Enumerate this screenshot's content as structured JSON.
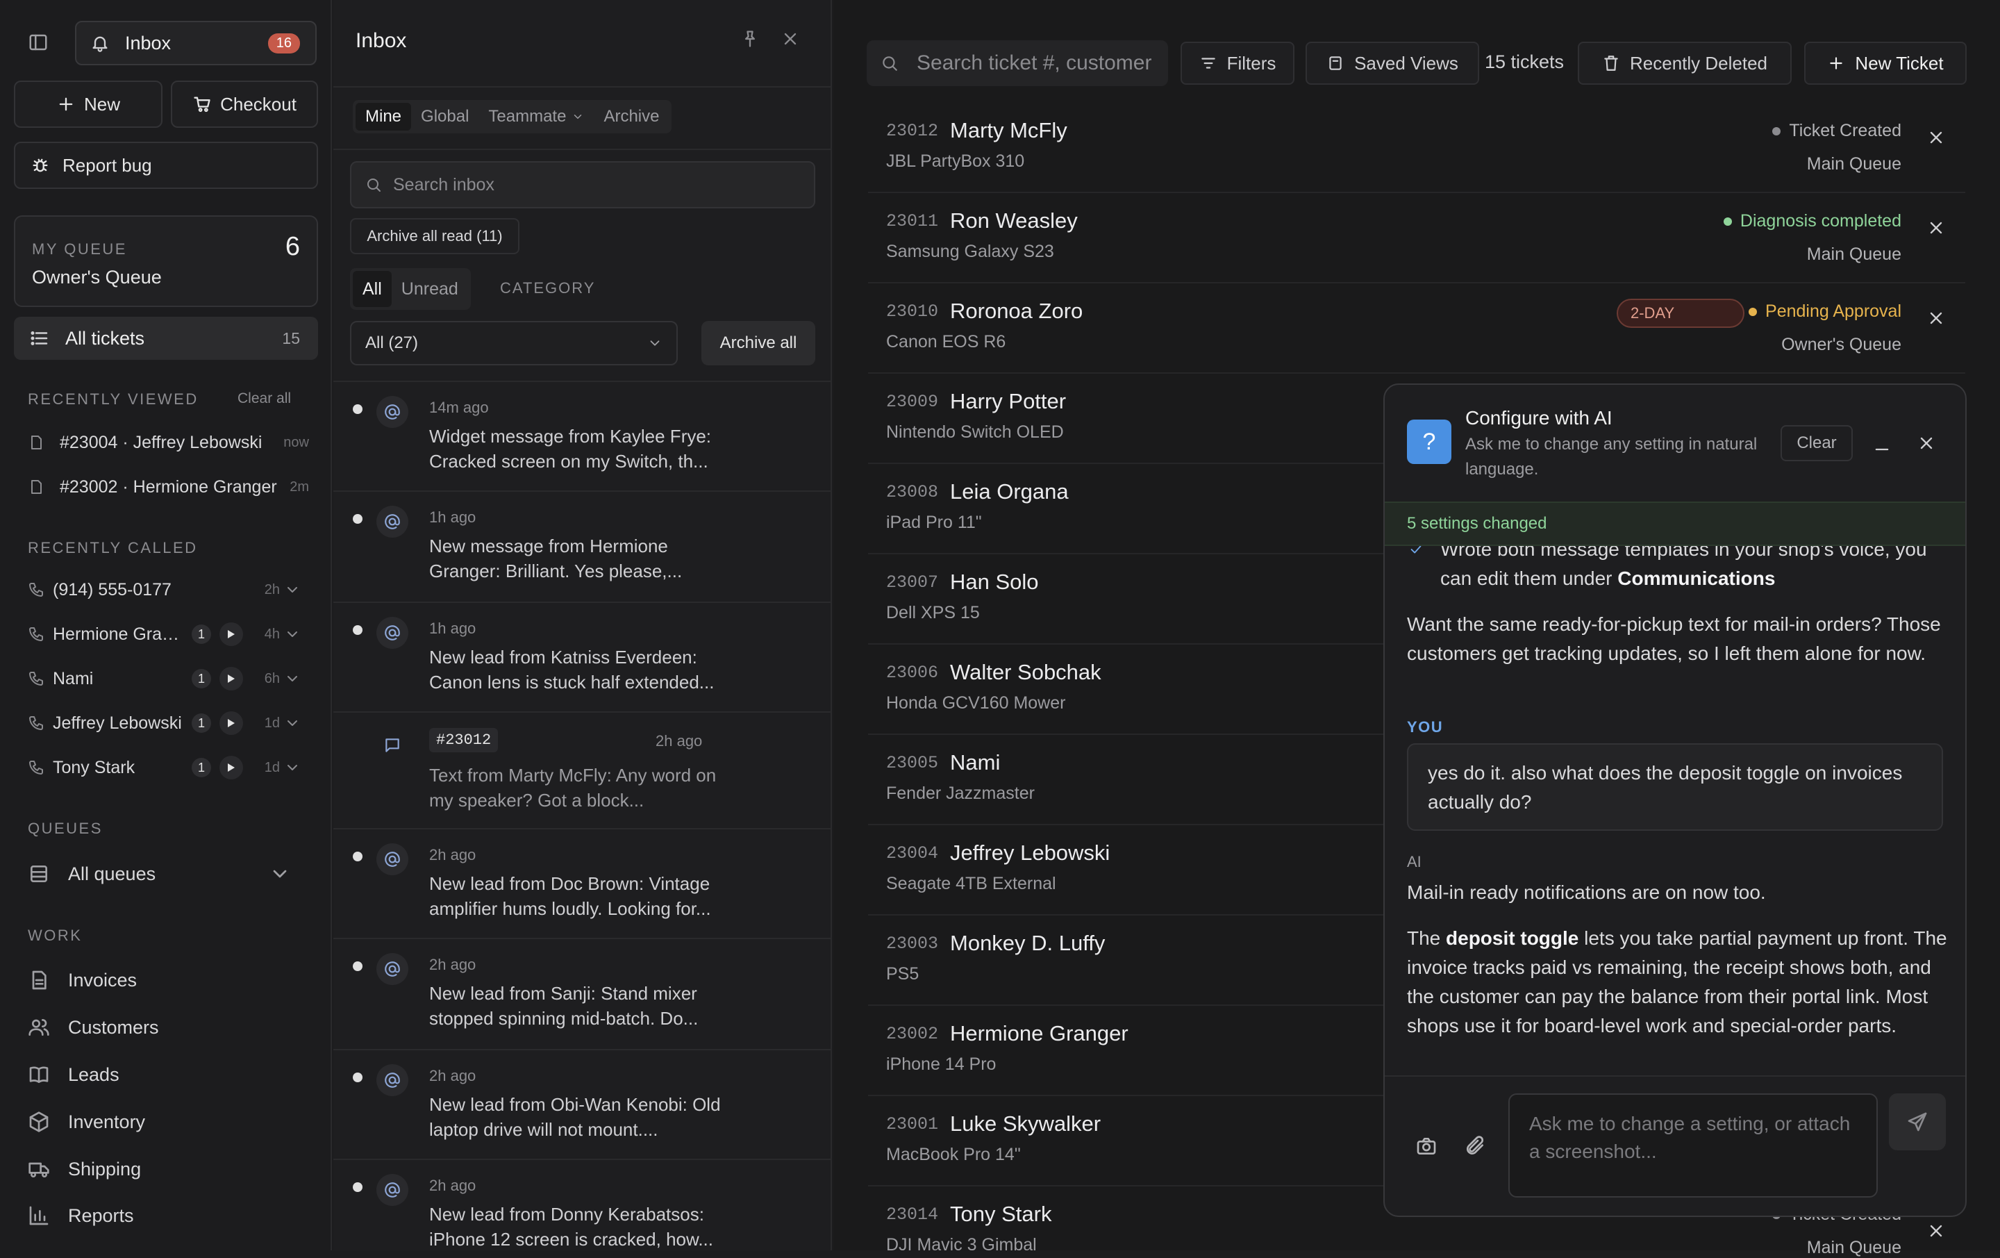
{
  "sidebar": {
    "inbox_label": "Inbox",
    "inbox_count": "16",
    "new_label": "New",
    "checkout_label": "Checkout",
    "report_bug_label": "Report bug",
    "queue": {
      "heading": "MY QUEUE",
      "name": "Owner's Queue",
      "count": "6"
    },
    "all_tickets": {
      "label": "All tickets",
      "count": "15"
    },
    "recently_viewed": {
      "heading": "RECENTLY VIEWED",
      "clear_label": "Clear all",
      "items": [
        {
          "label": "#23004 · Jeffrey Lebowski",
          "time": "now"
        },
        {
          "label": "#23002 · Hermione Granger",
          "time": "2m"
        }
      ]
    },
    "recently_called": {
      "heading": "RECENTLY CALLED",
      "items": [
        {
          "label": "(914) 555-0177",
          "count": "",
          "time": "2h"
        },
        {
          "label": "Hermione Granger",
          "count": "1",
          "time": "4h"
        },
        {
          "label": "Nami",
          "count": "1",
          "time": "6h"
        },
        {
          "label": "Jeffrey Lebowski",
          "count": "1",
          "time": "1d"
        },
        {
          "label": "Tony Stark",
          "count": "1",
          "time": "1d"
        }
      ]
    },
    "queues": {
      "heading": "QUEUES",
      "all_label": "All queues"
    },
    "work": {
      "heading": "WORK",
      "items": [
        {
          "label": "Invoices",
          "icon": "invoice-icon"
        },
        {
          "label": "Customers",
          "icon": "customers-icon"
        },
        {
          "label": "Leads",
          "icon": "book-icon"
        },
        {
          "label": "Inventory",
          "icon": "box-icon"
        },
        {
          "label": "Shipping",
          "icon": "truck-icon"
        },
        {
          "label": "Reports",
          "icon": "chart-icon"
        }
      ]
    }
  },
  "inbox": {
    "title": "Inbox",
    "scope_tabs": [
      "Mine",
      "Global",
      "Teammate",
      "Archive"
    ],
    "search_placeholder": "Search inbox",
    "archive_read_label": "Archive all read (11)",
    "read_tabs": [
      "All",
      "Unread"
    ],
    "category_label": "CATEGORY",
    "filter_value": "All (27)",
    "archive_all_label": "Archive all",
    "notifications": [
      {
        "time": "14m ago",
        "text": "Widget message from Kaylee Frye: Cracked screen on my Switch, th...",
        "unread": true
      },
      {
        "time": "1h ago",
        "text": "New message from Hermione Granger: Brilliant. Yes please,...",
        "unread": true
      },
      {
        "time": "1h ago",
        "text": "New lead from Katniss Everdeen: Canon lens is stuck half extended...",
        "unread": true
      },
      {
        "ticket": "#23012",
        "time": "2h ago",
        "text": "Text from Marty McFly: Any word on my speaker? Got a block...",
        "unread": false
      },
      {
        "time": "2h ago",
        "text": "New lead from Doc Brown: Vintage amplifier hums loudly. Looking for...",
        "unread": true
      },
      {
        "time": "2h ago",
        "text": "New lead from Sanji: Stand mixer stopped spinning mid-batch. Do...",
        "unread": true
      },
      {
        "time": "2h ago",
        "text": "New lead from Obi-Wan Kenobi: Old laptop drive will not mount....",
        "unread": true
      },
      {
        "time": "2h ago",
        "text": "New lead from Donny Kerabatsos: iPhone 12 screen is cracked, how...",
        "unread": true
      }
    ]
  },
  "toolbar": {
    "search_placeholder": "Search ticket #, customer",
    "filters_label": "Filters",
    "saved_views_label": "Saved Views",
    "ticket_count": "15 tickets",
    "recently_deleted_label": "Recently Deleted",
    "new_ticket_label": "New Ticket"
  },
  "tickets": [
    {
      "num": "23012",
      "name": "Marty McFly",
      "device": "JBL PartyBox 310",
      "status": "Ticket Created",
      "status_color": "#8b8b8f",
      "queue": "Main Queue"
    },
    {
      "num": "23011",
      "name": "Ron Weasley",
      "device": "Samsung Galaxy S23",
      "status": "Diagnosis completed",
      "status_color": "#8fd49a",
      "queue": "Main Queue"
    },
    {
      "num": "23010",
      "name": "Roronoa Zoro",
      "device": "Canon EOS R6",
      "status": "Pending Approval",
      "status_color": "#e6b34d",
      "queue": "Owner's Queue",
      "badge": "2-DAY"
    },
    {
      "num": "23009",
      "name": "Harry Potter",
      "device": "Nintendo Switch OLED"
    },
    {
      "num": "23008",
      "name": "Leia Organa",
      "device": "iPad Pro 11\""
    },
    {
      "num": "23007",
      "name": "Han Solo",
      "device": "Dell XPS 15"
    },
    {
      "num": "23006",
      "name": "Walter Sobchak",
      "device": "Honda GCV160 Mower"
    },
    {
      "num": "23005",
      "name": "Nami",
      "device": "Fender Jazzmaster"
    },
    {
      "num": "23004",
      "name": "Jeffrey Lebowski",
      "device": "Seagate 4TB External"
    },
    {
      "num": "23003",
      "name": "Monkey D. Luffy",
      "device": "PS5"
    },
    {
      "num": "23002",
      "name": "Hermione Granger",
      "device": "iPhone 14 Pro"
    },
    {
      "num": "23001",
      "name": "Luke Skywalker",
      "device": "MacBook Pro 14\""
    },
    {
      "num": "23014",
      "name": "Tony Stark",
      "device": "DJI Mavic 3 Gimbal",
      "status": "Ticket Created",
      "status_color": "#8b8b8f",
      "queue": "Main Queue"
    }
  ],
  "ai": {
    "title": "Configure with AI",
    "subtitle": "Ask me to change any setting in natural language.",
    "clear_label": "Clear",
    "changed_banner": "5 settings changed",
    "check_text_a": "Wrote both message templates in your shop's voice, you can edit them under ",
    "check_text_b": "Communications",
    "question": "Want the same ready-for-pickup text for mail-in orders? Those customers get tracking updates, so I left them alone for now.",
    "you_label": "YOU",
    "user_msg": "yes do it. also what does the deposit toggle on invoices actually do?",
    "ai_label": "AI",
    "reply1": "Mail-in ready notifications are on now too.",
    "reply2_a": "The ",
    "reply2_b": "deposit toggle",
    "reply2_c": " lets you take partial payment up front. The invoice tracks paid vs remaining, the receipt shows both, and the customer can pay the balance from their portal link. Most shops use it for board-level work and special-order parts.",
    "input_placeholder": "Ask me to change a setting, or attach a screenshot..."
  }
}
